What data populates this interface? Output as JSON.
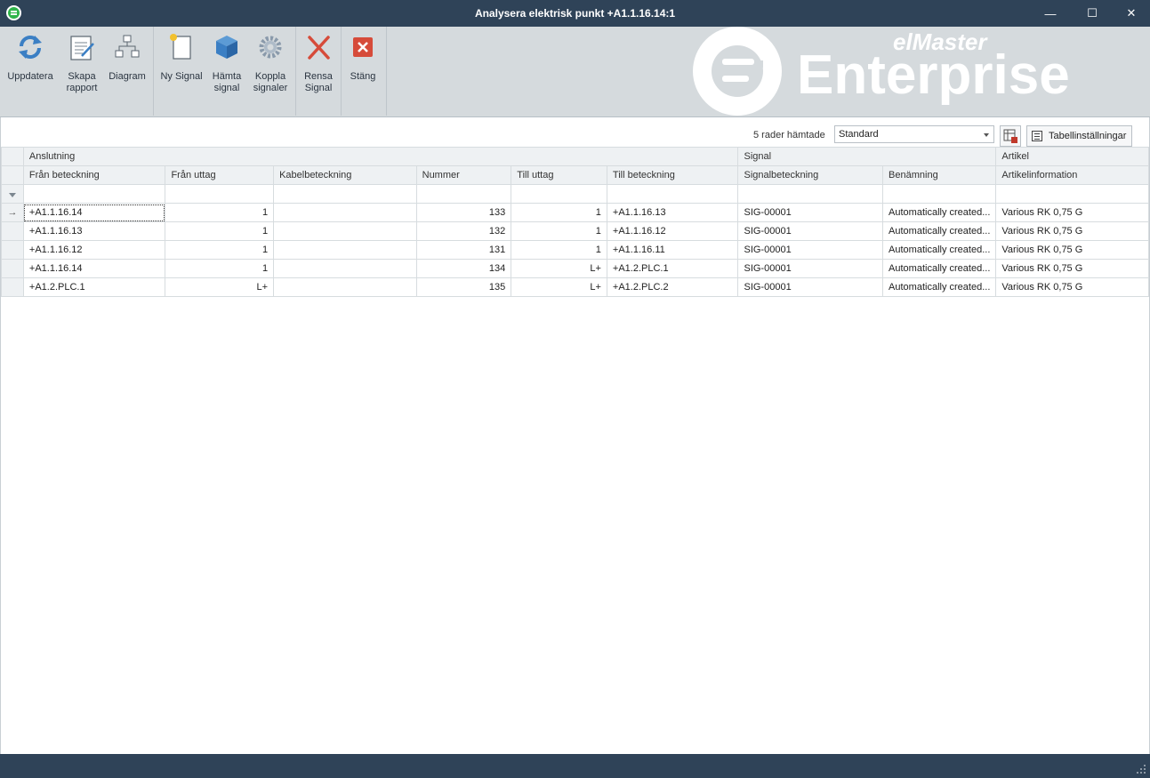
{
  "window": {
    "title": "Analysera elektrisk punkt +A1.1.16.14:1",
    "minimize_glyph": "—",
    "maximize_glyph": "☐",
    "close_glyph": "✕"
  },
  "ribbon": {
    "uppdatera": "Uppdatera",
    "skapa_1": "Skapa",
    "skapa_2": "rapport",
    "diagram": "Diagram",
    "ny_signal": "Ny Signal",
    "hamta_1": "Hämta",
    "hamta_2": "signal",
    "koppla_1": "Koppla",
    "koppla_2": "signaler",
    "rensa_1": "Rensa",
    "rensa_2": "Signal",
    "stang": "Stäng"
  },
  "logo": {
    "top": "elMaster",
    "main": "Enterprise"
  },
  "toolbar": {
    "row_count": "5 rader hämtade",
    "layout_value": "Standard",
    "table_settings": "Tabellinställningar"
  },
  "grid": {
    "bands": [
      "Anslutning",
      "Signal",
      "Artikel"
    ],
    "columns": [
      "Från beteckning",
      "Från uttag",
      "Kabelbeteckning",
      "Nummer",
      "Till uttag",
      "Till beteckning",
      "Signalbeteckning",
      "Benämning",
      "Artikelinformation"
    ],
    "current_row_glyph": "→",
    "rows": [
      [
        "+A1.1.16.14",
        "1",
        "",
        "133",
        "1",
        "+A1.1.16.13",
        "SIG-00001",
        "Automatically created...",
        "Various RK 0,75 G"
      ],
      [
        "+A1.1.16.13",
        "1",
        "",
        "132",
        "1",
        "+A1.1.16.12",
        "SIG-00001",
        "Automatically created...",
        "Various RK 0,75 G"
      ],
      [
        "+A1.1.16.12",
        "1",
        "",
        "131",
        "1",
        "+A1.1.16.11",
        "SIG-00001",
        "Automatically created...",
        "Various RK 0,75 G"
      ],
      [
        "+A1.1.16.14",
        "1",
        "",
        "134",
        "L+",
        "+A1.2.PLC.1",
        "SIG-00001",
        "Automatically created...",
        "Various RK 0,75 G"
      ],
      [
        "+A1.2.PLC.1",
        "L+",
        "",
        "135",
        "L+",
        "+A1.2.PLC.2",
        "SIG-00001",
        "Automatically created...",
        "Various RK 0,75 G"
      ]
    ]
  },
  "colors": {
    "titlebar": "#2f4358",
    "ribbon": "#d5dadd",
    "accent_green": "#2fb44a"
  }
}
